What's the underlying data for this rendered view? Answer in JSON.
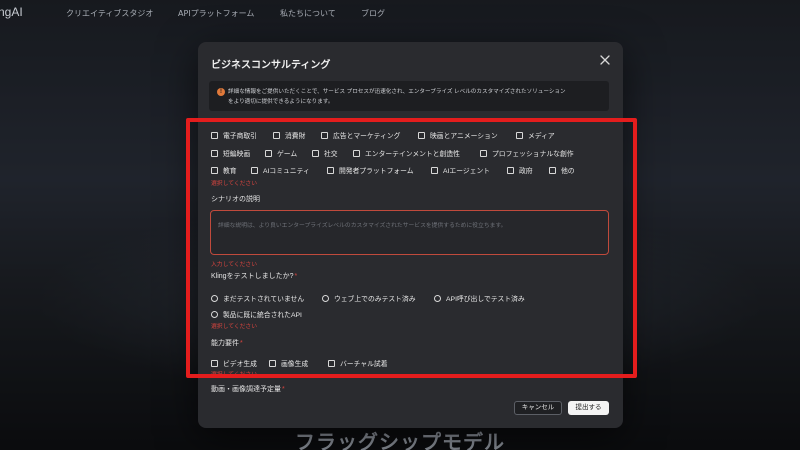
{
  "nav": {
    "logo": "ngAI",
    "links": [
      "クリエイティブスタジオ",
      "APIプラットフォーム",
      "私たちについて",
      "ブログ"
    ]
  },
  "background": {
    "headline": "フラッグシップモデル"
  },
  "modal": {
    "title": "ビジネスコンサルティング",
    "info_line1": "詳細な情報をご提供いただくことで、サービス プロセスが迅速化され、エンタープライズ レベルのカスタマイズされたソリューション",
    "info_line2": "をより適切に提供できるようになります。",
    "industries": [
      "電子商取引",
      "消費財",
      "広告とマーケティング",
      "映画とアニメーション",
      "メディア",
      "短編映画",
      "ゲーム",
      "社交",
      "エンターテインメントと創造性",
      "プロフェッショナルな創作",
      "教育",
      "AIコミュニティ",
      "開発者プラットフォーム",
      "AIエージェント",
      "政府",
      "他の"
    ],
    "industry_error": "選択してください",
    "scenario_label": "シナリオの説明",
    "scenario_placeholder": "詳細な説明は、より良いエンタープライズレベルのカスタマイズされたサービスを提供するために役立ちます。",
    "scenario_error": "入力してください",
    "kling_label": "Klingをテストしましたか?",
    "kling_options": [
      "まだテストされていません",
      "ウェブ上でのみテスト済み",
      "API呼び出しでテスト済み",
      "製品に既に統合されたAPI"
    ],
    "kling_error": "選択してください",
    "capability_label": "能力要件",
    "capabilities": [
      "ビデオ生成",
      "画像生成",
      "バーチャル試着"
    ],
    "capability_error": "選択してください",
    "budget_label": "動画・画像調達予定量",
    "cancel_label": "キャンセル",
    "submit_label": "提出する"
  },
  "colors": {
    "accent_error": "#d9453f",
    "highlight": "#e41d1d",
    "info_icon": "#e0793a"
  }
}
